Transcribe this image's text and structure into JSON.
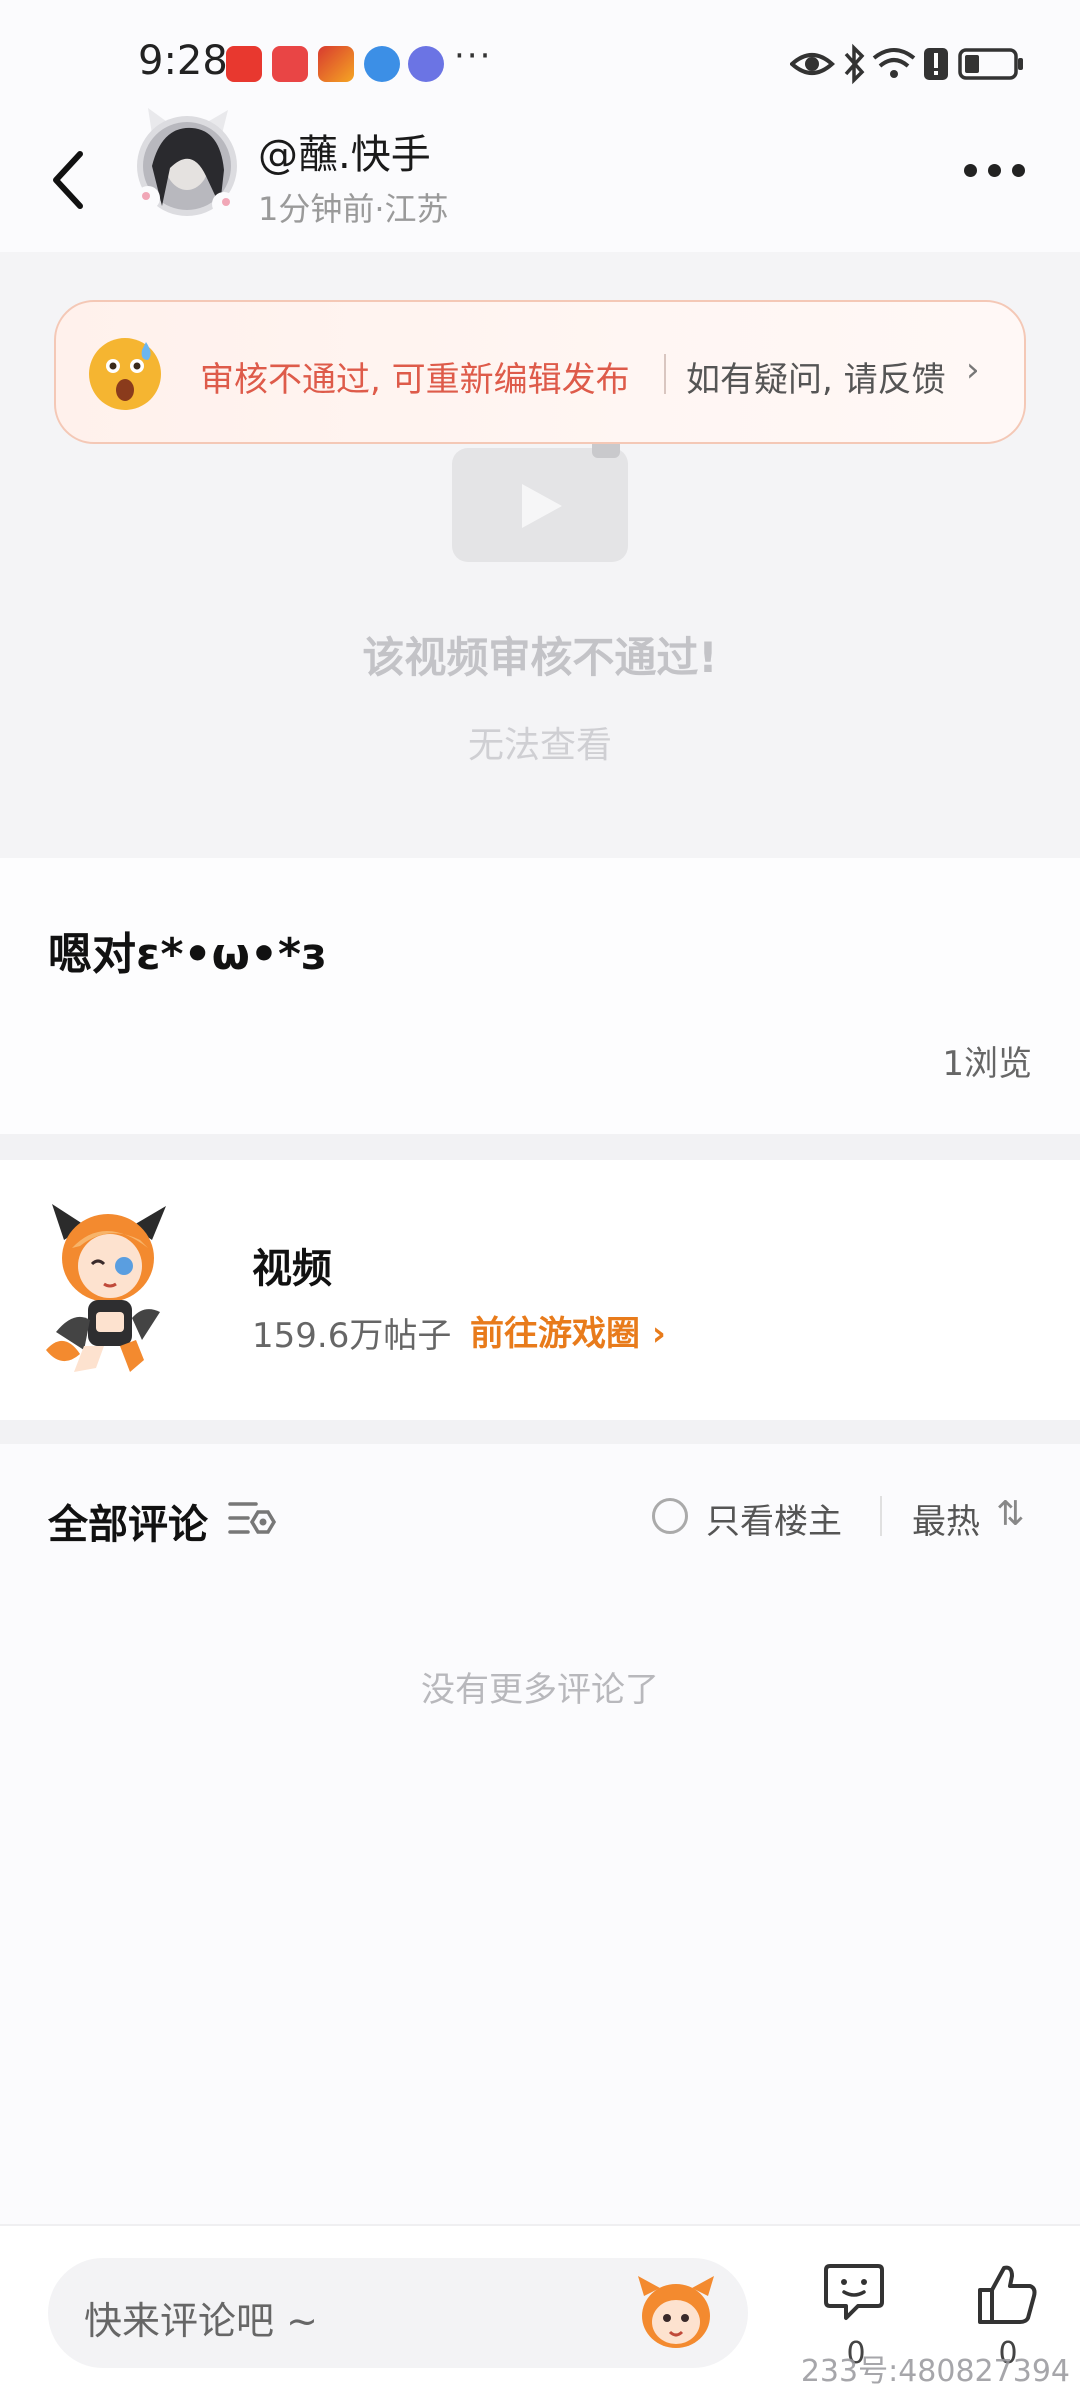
{
  "status_bar": {
    "time": "9:28",
    "dots": "···",
    "app_icons": [
      "xiaohongshu-icon",
      "huawei-store-icon",
      "game-app-icon",
      "browser-icon",
      "music-icon"
    ],
    "system_icons": [
      "eye-icon",
      "bluetooth-icon",
      "wifi-icon",
      "alert-icon",
      "battery-icon"
    ]
  },
  "header": {
    "username": "@蘸.快手",
    "meta": "1分钟前·江苏"
  },
  "notice": {
    "message": "审核不通过, 可重新编辑发布",
    "feedback": "如有疑问, 请反馈",
    "arrow": "›"
  },
  "video": {
    "title": "该视频审核不通过!",
    "subtitle": "无法查看"
  },
  "post": {
    "text": "嗯对ε*•ω•*з",
    "views": "1浏览"
  },
  "circle": {
    "name": "视频",
    "count": "159.6万帖子",
    "link": "前往游戏圈 ›"
  },
  "comments": {
    "title": "全部评论",
    "only_op": "只看楼主",
    "sort": "最热",
    "sort_icon": "⇅",
    "empty": "没有更多评论了"
  },
  "bottom_bar": {
    "placeholder": "快来评论吧 ~",
    "message_count": "0",
    "like_count": "0"
  },
  "watermark": "233号:480827394",
  "colors": {
    "warning_text": "#de5b4a",
    "accent_orange": "#e87b1b",
    "notice_border": "#f4c8b6"
  }
}
